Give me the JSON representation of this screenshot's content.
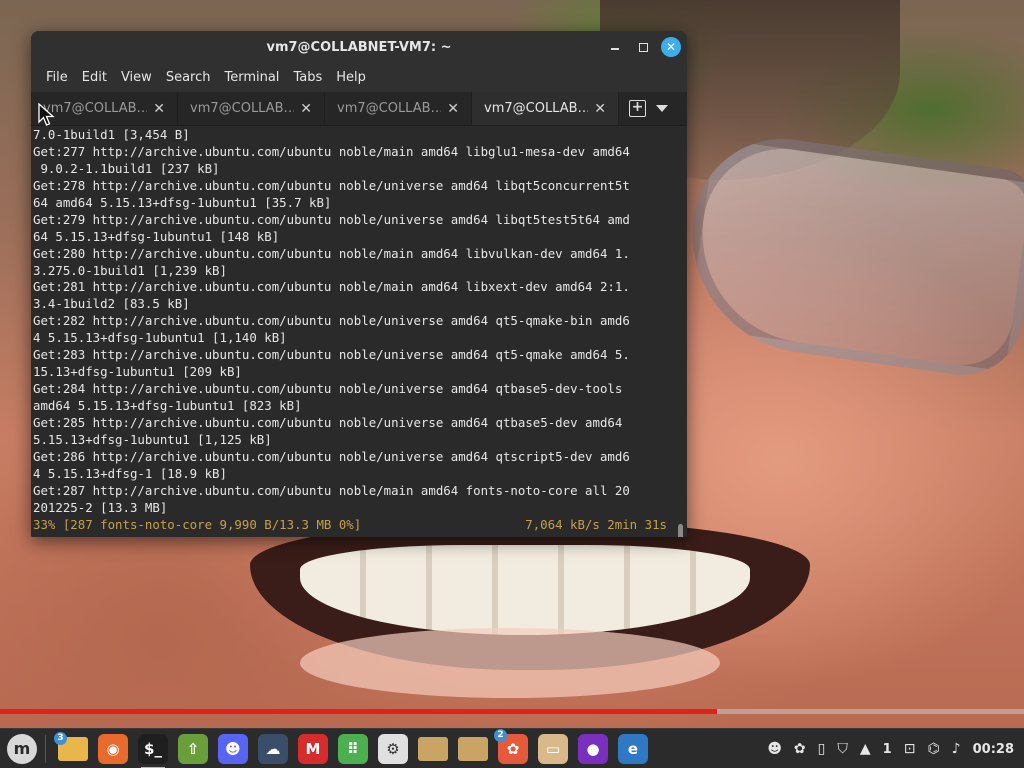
{
  "window": {
    "title": "vm7@COLLABNET-VM7: ~",
    "close_glyph": "✕"
  },
  "menubar": {
    "items": [
      "File",
      "Edit",
      "View",
      "Search",
      "Terminal",
      "Tabs",
      "Help"
    ]
  },
  "tabs": [
    {
      "label": "vm7@COLLAB…",
      "active": false
    },
    {
      "label": "vm7@COLLAB…",
      "active": false
    },
    {
      "label": "vm7@COLLAB…",
      "active": false
    },
    {
      "label": "vm7@COLLAB…",
      "active": true
    }
  ],
  "tab_close_glyph": "✕",
  "terminal": {
    "lines": [
      "7.0-1build1 [3,454 B]",
      "Get:277 http://archive.ubuntu.com/ubuntu noble/main amd64 libglu1-mesa-dev amd64",
      " 9.0.2-1.1build1 [237 kB]",
      "Get:278 http://archive.ubuntu.com/ubuntu noble/universe amd64 libqt5concurrent5t",
      "64 amd64 5.15.13+dfsg-1ubuntu1 [35.7 kB]",
      "Get:279 http://archive.ubuntu.com/ubuntu noble/universe amd64 libqt5test5t64 amd",
      "64 5.15.13+dfsg-1ubuntu1 [148 kB]",
      "Get:280 http://archive.ubuntu.com/ubuntu noble/main amd64 libvulkan-dev amd64 1.",
      "3.275.0-1build1 [1,239 kB]",
      "Get:281 http://archive.ubuntu.com/ubuntu noble/main amd64 libxext-dev amd64 2:1.",
      "3.4-1build2 [83.5 kB]",
      "Get:282 http://archive.ubuntu.com/ubuntu noble/universe amd64 qt5-qmake-bin amd6",
      "4 5.15.13+dfsg-1ubuntu1 [1,140 kB]",
      "Get:283 http://archive.ubuntu.com/ubuntu noble/universe amd64 qt5-qmake amd64 5.",
      "15.13+dfsg-1ubuntu1 [209 kB]",
      "Get:284 http://archive.ubuntu.com/ubuntu noble/universe amd64 qtbase5-dev-tools",
      "amd64 5.15.13+dfsg-1ubuntu1 [823 kB]",
      "Get:285 http://archive.ubuntu.com/ubuntu noble/universe amd64 qtbase5-dev amd64",
      "5.15.13+dfsg-1ubuntu1 [1,125 kB]",
      "Get:286 http://archive.ubuntu.com/ubuntu noble/universe amd64 qtscript5-dev amd6",
      "4 5.15.13+dfsg-1 [18.9 kB]",
      "Get:287 http://archive.ubuntu.com/ubuntu noble/main amd64 fonts-noto-core all 20",
      "201225-2 [13.3 MB]"
    ],
    "status_left": "33% [287 fonts-noto-core 9,990 B/13.3 MB 0%]",
    "status_right": "7,064 kB/s 2min 31s",
    "status_color": "#c8a04a"
  },
  "video_progress": {
    "fraction": 0.7,
    "color": "#e2211c"
  },
  "taskbar": {
    "menu_button_glyph": "m",
    "launchers": [
      {
        "name": "files-folder-icon",
        "glyph": "",
        "bg": "#e8b64a",
        "badge": "3"
      },
      {
        "name": "firefox-icon",
        "glyph": "◉",
        "bg": "#e86a2c",
        "badge": ""
      },
      {
        "name": "terminal-icon",
        "glyph": "$_",
        "bg": "#1f1f1f",
        "badge": "",
        "active": true
      },
      {
        "name": "update-manager-icon",
        "glyph": "⇧",
        "bg": "#6a9e3a",
        "badge": ""
      },
      {
        "name": "discord-icon",
        "glyph": "☻",
        "bg": "#5865f2",
        "badge": ""
      },
      {
        "name": "cloud-sync-icon",
        "glyph": "☁",
        "bg": "#3a4e6a",
        "badge": ""
      },
      {
        "name": "mario-game-icon",
        "glyph": "M",
        "bg": "#d62c2c",
        "badge": ""
      },
      {
        "name": "app-grid-icon",
        "glyph": "⠿",
        "bg": "#4caf50",
        "badge": ""
      },
      {
        "name": "settings-gear-icon",
        "glyph": "⚙",
        "bg": "#e0e0e0",
        "badge": ""
      },
      {
        "name": "folder-icon",
        "glyph": "",
        "bg": "#c9a465",
        "badge": ""
      },
      {
        "name": "folder-2-icon",
        "glyph": "",
        "bg": "#c9a465",
        "badge": ""
      },
      {
        "name": "bee-app-icon",
        "glyph": "✿",
        "bg": "#e55a3a",
        "badge": "2"
      },
      {
        "name": "archive-box-icon",
        "glyph": "▭",
        "bg": "#d9b88a",
        "badge": ""
      },
      {
        "name": "purple-orb-icon",
        "glyph": "●",
        "bg": "#7b2fbf",
        "badge": ""
      },
      {
        "name": "web-browser-globe-icon",
        "glyph": "e",
        "bg": "#2f78c4",
        "badge": ""
      }
    ],
    "tray": {
      "discord_glyph": "☻",
      "bee_glyph": "✿",
      "clipboard_glyph": "▯",
      "shield_glyph": "⛉",
      "notifications_glyph": "▲",
      "workspace": "1",
      "window_list_glyph": "⊡",
      "network_glyph": "⌬",
      "volume_glyph": "♪",
      "clock": "00:28"
    }
  }
}
